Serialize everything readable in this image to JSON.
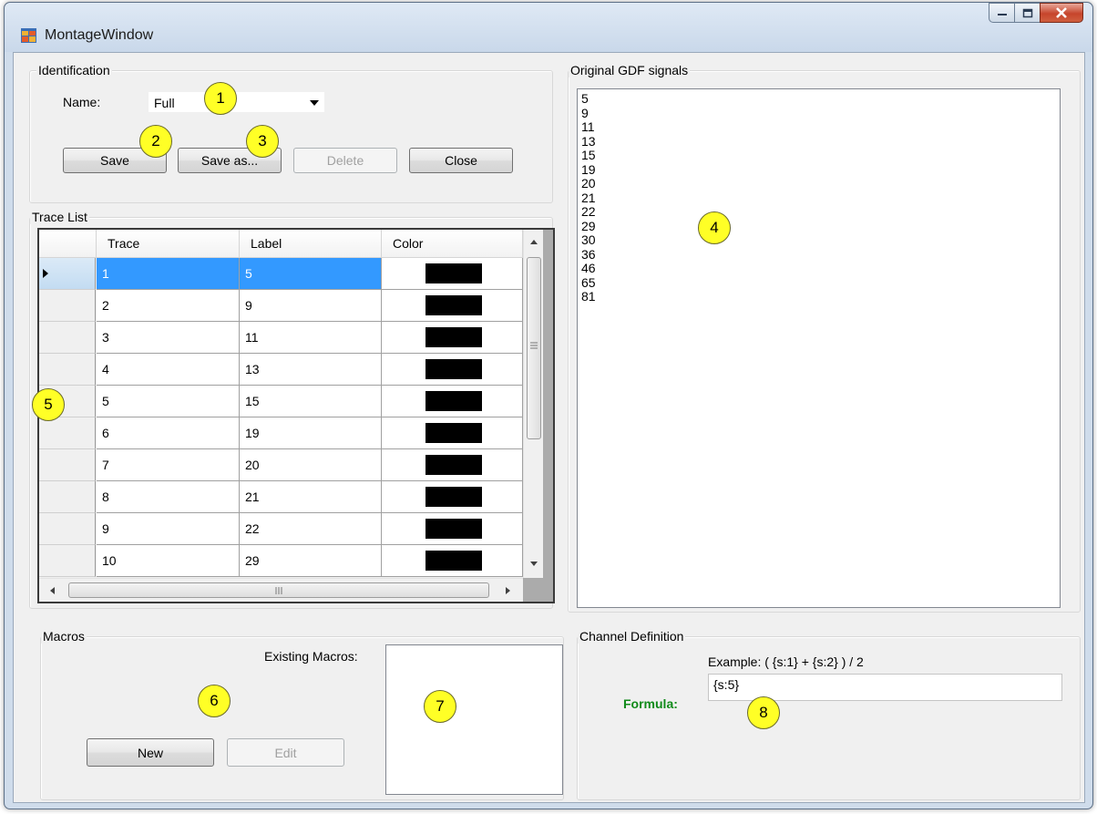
{
  "window": {
    "title": "MontageWindow"
  },
  "identification": {
    "group_label": "Identification",
    "name_label": "Name:",
    "name_value": "Full",
    "buttons": {
      "save": "Save",
      "save_as": "Save as...",
      "delete": "Delete",
      "close": "Close"
    }
  },
  "trace_list": {
    "group_label": "Trace List",
    "columns": [
      "Trace",
      "Label",
      "Color"
    ],
    "rows": [
      {
        "trace": "1",
        "label": "5",
        "color": "#000000",
        "selected": true
      },
      {
        "trace": "2",
        "label": "9",
        "color": "#000000"
      },
      {
        "trace": "3",
        "label": "11",
        "color": "#000000"
      },
      {
        "trace": "4",
        "label": "13",
        "color": "#000000"
      },
      {
        "trace": "5",
        "label": "15",
        "color": "#000000"
      },
      {
        "trace": "6",
        "label": "19",
        "color": "#000000"
      },
      {
        "trace": "7",
        "label": "20",
        "color": "#000000"
      },
      {
        "trace": "8",
        "label": "21",
        "color": "#000000"
      },
      {
        "trace": "9",
        "label": "22",
        "color": "#000000"
      },
      {
        "trace": "10",
        "label": "29",
        "color": "#000000"
      }
    ]
  },
  "original_signals": {
    "group_label": "Original GDF signals",
    "items": [
      "5",
      "9",
      "11",
      "13",
      "15",
      "19",
      "20",
      "21",
      "22",
      "29",
      "30",
      "36",
      "46",
      "65",
      "81"
    ]
  },
  "macros": {
    "group_label": "Macros",
    "existing_label": "Existing Macros:",
    "new_button": "New",
    "edit_button": "Edit"
  },
  "channel_definition": {
    "group_label": "Channel Definition",
    "example": "Example: ( {s:1} + {s:2} ) / 2",
    "formula_label": "Formula:",
    "formula_value": "{s:5}"
  },
  "callouts": [
    "1",
    "2",
    "3",
    "4",
    "5",
    "6",
    "7",
    "8"
  ],
  "colors": {
    "selection": "#3399ff",
    "formula_label": "#008000",
    "callout_fill": "#ffff26"
  }
}
